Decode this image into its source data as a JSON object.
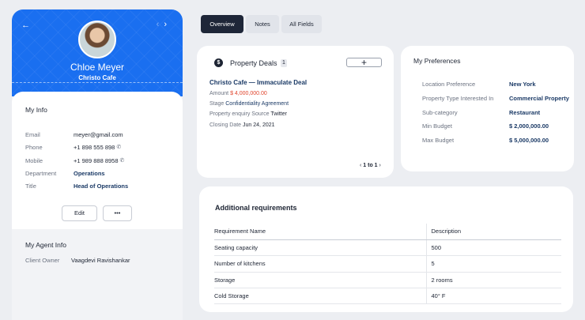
{
  "profile": {
    "name": "Chloe Meyer",
    "company": "Christo Cafe",
    "back_icon": "arrow-left-icon",
    "prev_icon": "chevron-left-icon",
    "next_icon": "chevron-right-icon"
  },
  "my_info": {
    "title": "My Info",
    "fields": [
      {
        "label": "Email",
        "value": "meyer@gmail.com"
      },
      {
        "label": "Phone",
        "value": "+1 898 555 898"
      },
      {
        "label": "Mobile",
        "value": "+1 989 888 8958"
      },
      {
        "label": "Department",
        "value": "Operations"
      },
      {
        "label": "Title",
        "value": "Head of Operations"
      }
    ],
    "edit_label": "Edit",
    "more_label": "•••"
  },
  "agent_info": {
    "title": "My Agent Info",
    "client_owner_label": "Client Owner",
    "client_owner_value": "Vaagdevi Ravishankar"
  },
  "tabs": [
    {
      "label": "Overview",
      "active": true
    },
    {
      "label": "Notes",
      "active": false
    },
    {
      "label": "All Fields",
      "active": false
    }
  ],
  "deals": {
    "icon_glyph": "$",
    "title": "Property Deals",
    "count": "1",
    "add_label": "+",
    "deal_name": "Christo Cafe — Immaculate Deal",
    "amount_label": "Amount",
    "amount_value": "$ 4,000,000.00",
    "stage_label": "Stage",
    "stage_value": "Confidentiality Agreement",
    "source_label": "Property enquiry Source",
    "source_value": "Twitter",
    "closing_label": "Closing Date",
    "closing_value": "Jun 24, 2021",
    "pager_prev": "‹",
    "pager_text": "1 to 1",
    "pager_next": "›"
  },
  "preferences": {
    "title": "My Preferences",
    "rows": [
      {
        "label": "Location Preference",
        "value": "New York"
      },
      {
        "label": "Property Type Interested In",
        "value": "Commercial Property"
      },
      {
        "label": "Sub-category",
        "value": "Restaurant"
      },
      {
        "label": "Min Budget",
        "value": "$ 2,000,000.00"
      },
      {
        "label": "Max Budget",
        "value": "$ 5,000,000.00"
      }
    ]
  },
  "requirements": {
    "title": "Additional requirements",
    "col_name": "Requirement Name",
    "col_desc": "Description",
    "rows": [
      {
        "name": "Seating capacity",
        "desc": "500"
      },
      {
        "name": "Number of kitchens",
        "desc": "5"
      },
      {
        "name": "Storage",
        "desc": "2 rooms"
      },
      {
        "name": "Cold Storage",
        "desc": "40° F"
      }
    ]
  },
  "colors": {
    "brand_blue": "#1a6ff0",
    "navy": "#1b3a66",
    "amount_red": "#e0452d",
    "active_tab": "#1e2638"
  }
}
